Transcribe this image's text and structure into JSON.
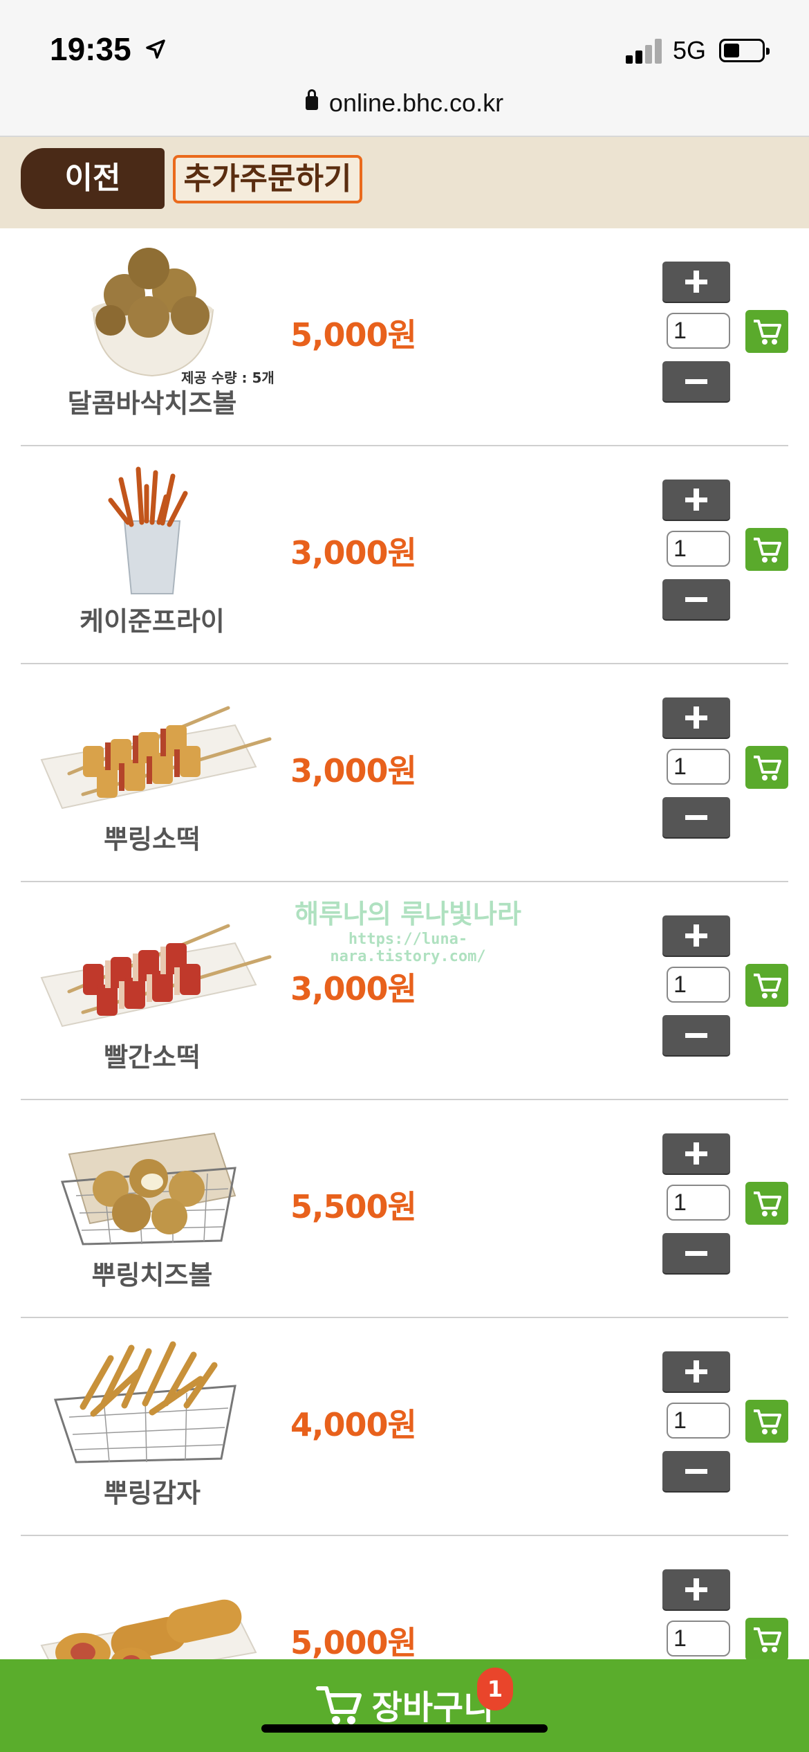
{
  "status_bar": {
    "time": "19:35",
    "network": "5G",
    "url": "online.bhc.co.kr"
  },
  "header": {
    "prev_label": "이전",
    "more_order_label": "추가주문하기"
  },
  "products": [
    {
      "name": "달콤바삭치즈볼",
      "price": "5,000원",
      "qty": "1",
      "note": "제공 수량 : 5개"
    },
    {
      "name": "케이준프라이",
      "price": "3,000원",
      "qty": "1"
    },
    {
      "name": "뿌링소떡",
      "price": "3,000원",
      "qty": "1"
    },
    {
      "name": "빨간소떡",
      "price": "3,000원",
      "qty": "1"
    },
    {
      "name": "뿌링치즈볼",
      "price": "5,500원",
      "qty": "1"
    },
    {
      "name": "뿌링감자",
      "price": "4,000원",
      "qty": "1"
    },
    {
      "name": "",
      "price": "5,000원",
      "qty": "1"
    }
  ],
  "watermark": {
    "line1": "해루나의 루나빛나라",
    "line2": "https://luna-nara.tistory.com/"
  },
  "cart_bar": {
    "label": "장바구니",
    "badge_count": "1"
  },
  "colors": {
    "price": "#e8611c",
    "cart_green": "#5aad2c",
    "header_bg": "#ece3d1",
    "prev_btn": "#4a2a17"
  }
}
